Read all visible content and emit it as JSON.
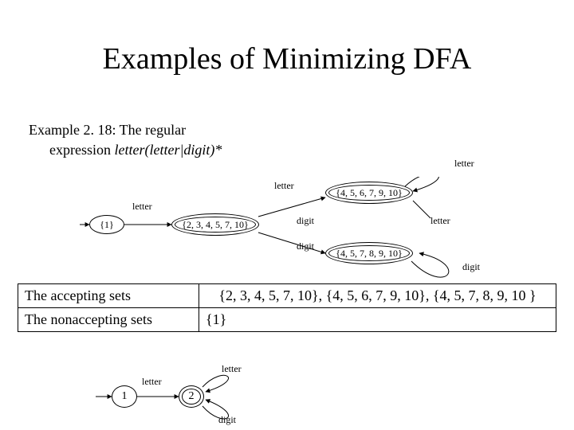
{
  "title": "Examples of Minimizing DFA",
  "subtitle": {
    "line1": "Example 2. 18: The regular",
    "line2_plain": "expression ",
    "line2_expr": "letter(letter|digit)*"
  },
  "dfa1": {
    "states": {
      "s1": "{1}",
      "s2": "{2, 3, 4, 5, 7, 10}",
      "s3": "{4, 5, 6, 7, 9, 10}",
      "s4": "{4, 5, 7, 8, 9, 10}"
    },
    "edges": {
      "start_to_s1": "letter",
      "s2_letter": "letter",
      "s2_digit": "digit",
      "s3_self_letter": "letter",
      "s3_to_s4_letter": "letter",
      "s4_self_digit": "digit"
    }
  },
  "sets": {
    "accepting_label": "The accepting sets",
    "accepting_value": "{2, 3, 4, 5, 7, 10}, {4, 5, 6, 7, 9, 10}, {4, 5, 7, 8, 9, 10 }",
    "nonaccepting_label": "The nonaccepting sets",
    "nonaccepting_value": "{1}"
  },
  "dfa2": {
    "states": {
      "a": "1",
      "b": "2"
    },
    "edges": {
      "a_to_b": "letter",
      "b_letter": "letter",
      "b_digit": "digit"
    }
  },
  "chart_data": [
    {
      "type": "diagram",
      "title": "DFA before minimizing",
      "nodes": [
        {
          "id": "s1",
          "label": "{1}",
          "accepting": false
        },
        {
          "id": "s2",
          "label": "{2,3,4,5,7,10}",
          "accepting": true
        },
        {
          "id": "s3",
          "label": "{4,5,6,7,9,10}",
          "accepting": true
        },
        {
          "id": "s4",
          "label": "{4,5,7,8,9,10}",
          "accepting": true
        }
      ],
      "edges": [
        {
          "from": "s1",
          "to": "s2",
          "label": "letter"
        },
        {
          "from": "s2",
          "to": "s3",
          "label": "letter"
        },
        {
          "from": "s2",
          "to": "s4",
          "label": "digit"
        },
        {
          "from": "s3",
          "to": "s3",
          "label": "letter"
        },
        {
          "from": "s3",
          "to": "s4",
          "label": "letter"
        },
        {
          "from": "s4",
          "to": "s4",
          "label": "digit"
        }
      ]
    },
    {
      "type": "diagram",
      "title": "Minimized DFA",
      "nodes": [
        {
          "id": "1",
          "label": "1",
          "accepting": false
        },
        {
          "id": "2",
          "label": "2",
          "accepting": true
        }
      ],
      "edges": [
        {
          "from": "1",
          "to": "2",
          "label": "letter"
        },
        {
          "from": "2",
          "to": "2",
          "label": "letter"
        },
        {
          "from": "2",
          "to": "2",
          "label": "digit"
        }
      ]
    }
  ]
}
